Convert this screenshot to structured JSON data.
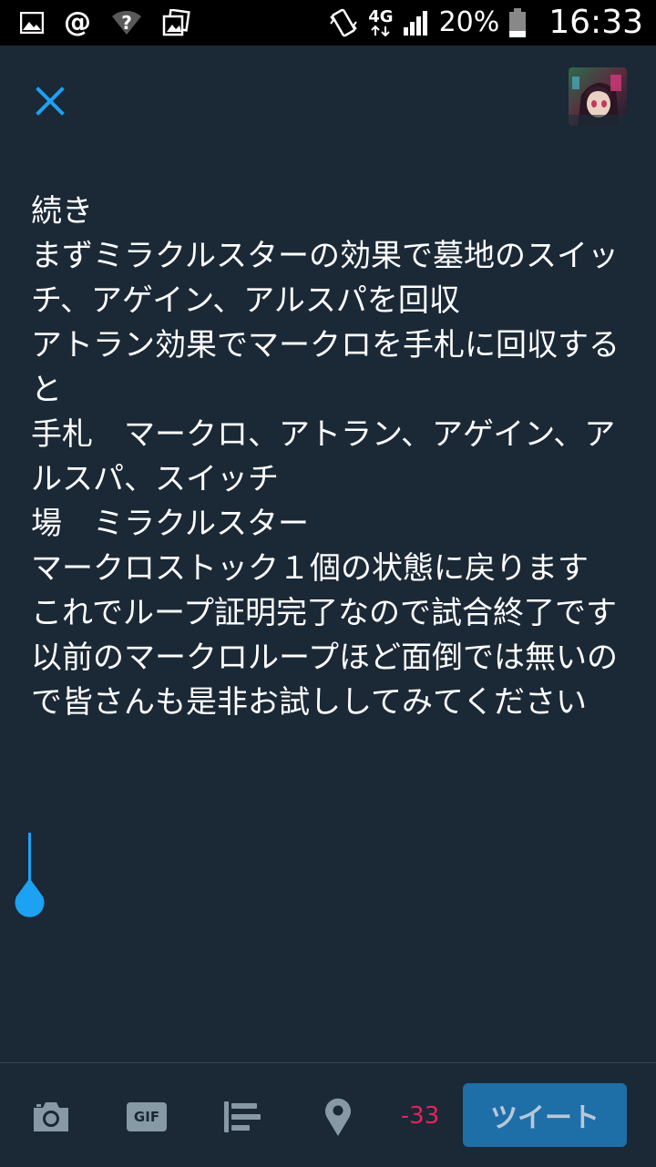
{
  "status_bar": {
    "left_icons": [
      "image-icon",
      "at-icon",
      "wifi-unknown-icon",
      "photos-icon"
    ],
    "at_symbol": "@",
    "network": "4G",
    "battery_percent": "20%",
    "time": "16:33"
  },
  "header": {
    "close_icon": "close-icon",
    "avatar_icon": "avatar"
  },
  "composer": {
    "text": "続き\nまずミラクルスターの効果で墓地のスイッチ、アゲイン、アルスパを回収\nアトラン効果でマークロを手札に回収すると\n手札　マークロ、アトラン、アゲイン、アルスパ、スイッチ\n場　ミラクルスター\nマークロストック１個の状態に戻ります\nこれでループ証明完了なので試合終了です\n以前のマークロループほど面倒では無いので皆さんも是非お試ししてみてください"
  },
  "toolbar": {
    "icons": [
      "camera-icon",
      "gif-icon",
      "poll-icon",
      "location-icon"
    ],
    "gif_label": "GIF",
    "char_count": "-33",
    "tweet_label": "ツイート"
  },
  "colors": {
    "background": "#1b2836",
    "accent": "#1da1f2",
    "tweet_button": "#1e6ea7",
    "char_count_negative": "#e0245e",
    "icon": "#8899a6"
  }
}
